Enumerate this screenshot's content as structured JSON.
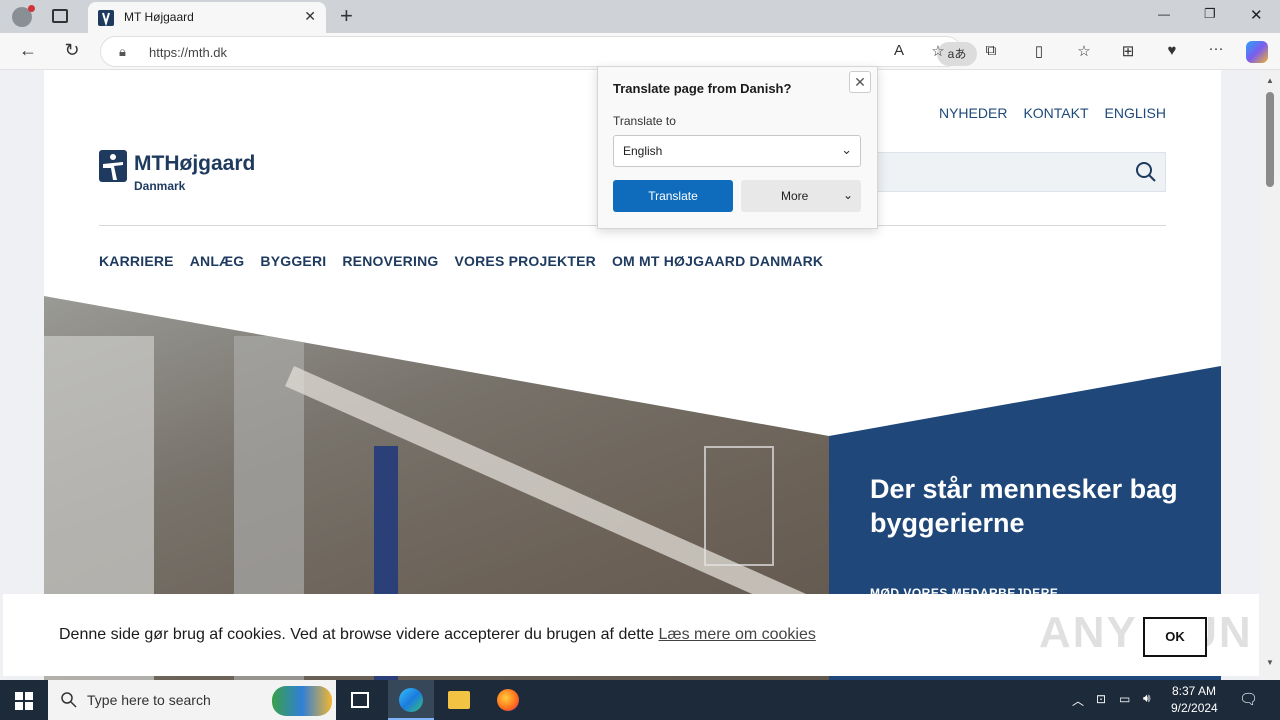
{
  "browser": {
    "tab_title": "MT Højgaard",
    "tab_close": "✕",
    "new_tab": "+",
    "url": "https://mth.dk",
    "window_controls": {
      "minimize": "—",
      "restore": "❐",
      "close": "✕"
    },
    "translate_icon_label": "aあ"
  },
  "site": {
    "logo_brand": "MTHøjgaard",
    "logo_sub": "Danmark",
    "top_links": [
      "NYHEDER",
      "KONTAKT",
      "ENGLISH"
    ],
    "nav": [
      "KARRIERE",
      "ANLÆG",
      "BYGGERI",
      "RENOVERING",
      "VORES PROJEKTER",
      "OM MT HØJGAARD DANMARK"
    ],
    "hero_headline": "Der står mennesker bag byggerierne",
    "hero_sub": "MØD VORES MEDARBEJDERE"
  },
  "translate_popup": {
    "title": "Translate page from Danish?",
    "translate_to_label": "Translate to",
    "language_value": "English",
    "translate_button": "Translate",
    "more_button": "More",
    "close": "✕"
  },
  "cookie": {
    "text": "Denne side gør brug af cookies. Ved at browse videre accepterer du brugen af dette ",
    "link": "Læs mere om cookies",
    "ok": "OK",
    "watermark": "ANY RUN"
  },
  "taskbar": {
    "search_placeholder": "Type here to search",
    "time": "8:37 AM",
    "date": "9/2/2024"
  },
  "colors": {
    "brand_navy": "#1e3a5f",
    "hero_blue": "#1f4779",
    "translate_blue": "#0f6cbd"
  }
}
